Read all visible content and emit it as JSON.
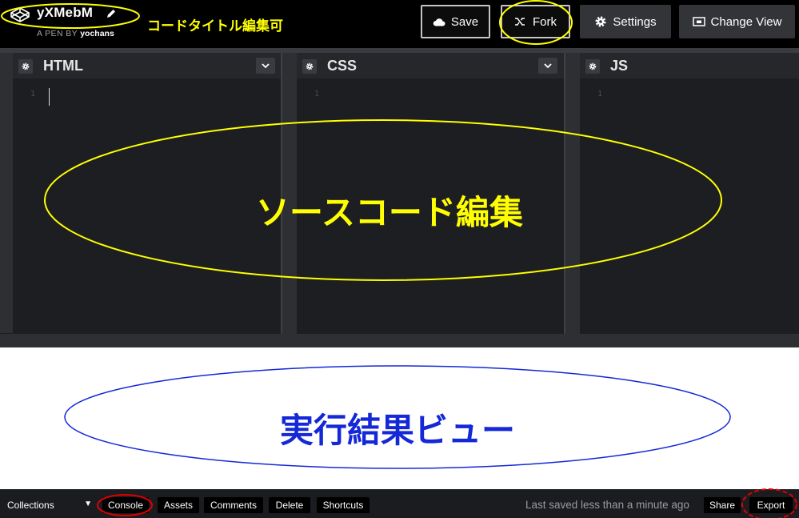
{
  "header": {
    "pen_title": "yXMebM",
    "pen_by_prefix": "A PEN BY",
    "author": "yochans",
    "title_annotation": "コードタイトル編集可",
    "buttons": {
      "save": "Save",
      "fork": "Fork",
      "settings": "Settings",
      "change_view": "Change View"
    }
  },
  "editors": {
    "panes": [
      {
        "name": "HTML",
        "line_number": "1"
      },
      {
        "name": "CSS",
        "line_number": "1"
      },
      {
        "name": "JS",
        "line_number": "1"
      }
    ],
    "annotation": "ソースコード編集"
  },
  "result": {
    "annotation": "実行結果ビュー"
  },
  "footer": {
    "collections": "Collections",
    "buttons": {
      "console": "Console",
      "assets": "Assets",
      "comments": "Comments",
      "delete": "Delete",
      "shortcuts": "Shortcuts",
      "share": "Share",
      "export": "Export"
    },
    "saved_message": "Last saved less than a minute ago"
  },
  "colors": {
    "annotation_yellow": "#ffff00",
    "annotation_red": "#e00000",
    "annotation_blue": "#1428d8",
    "editor_bg": "#1d1e22",
    "header_bg": "#000000"
  },
  "icons": {
    "logo": "codepen-logo-icon",
    "edit": "pencil-icon",
    "save": "cloud-icon",
    "fork": "fork-icon",
    "settings": "gear-icon",
    "change_view": "layout-icon",
    "pane_settings": "gear-icon",
    "pane_menu": "chevron-down-icon",
    "collections": "caret-down-icon"
  }
}
